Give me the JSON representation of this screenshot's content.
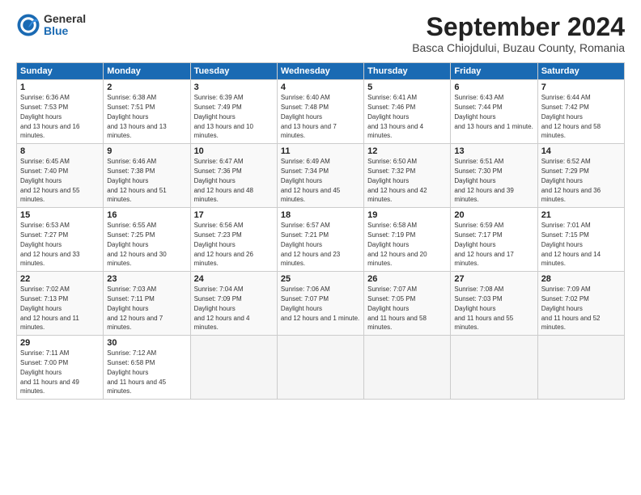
{
  "logo": {
    "general": "General",
    "blue": "Blue"
  },
  "title": "September 2024",
  "subtitle": "Basca Chiojdului, Buzau County, Romania",
  "headers": [
    "Sunday",
    "Monday",
    "Tuesday",
    "Wednesday",
    "Thursday",
    "Friday",
    "Saturday"
  ],
  "weeks": [
    [
      {
        "num": "1",
        "rise": "6:36 AM",
        "set": "7:53 PM",
        "daylight": "13 hours and 16 minutes."
      },
      {
        "num": "2",
        "rise": "6:38 AM",
        "set": "7:51 PM",
        "daylight": "13 hours and 13 minutes."
      },
      {
        "num": "3",
        "rise": "6:39 AM",
        "set": "7:49 PM",
        "daylight": "13 hours and 10 minutes."
      },
      {
        "num": "4",
        "rise": "6:40 AM",
        "set": "7:48 PM",
        "daylight": "13 hours and 7 minutes."
      },
      {
        "num": "5",
        "rise": "6:41 AM",
        "set": "7:46 PM",
        "daylight": "13 hours and 4 minutes."
      },
      {
        "num": "6",
        "rise": "6:43 AM",
        "set": "7:44 PM",
        "daylight": "13 hours and 1 minute."
      },
      {
        "num": "7",
        "rise": "6:44 AM",
        "set": "7:42 PM",
        "daylight": "12 hours and 58 minutes."
      }
    ],
    [
      {
        "num": "8",
        "rise": "6:45 AM",
        "set": "7:40 PM",
        "daylight": "12 hours and 55 minutes."
      },
      {
        "num": "9",
        "rise": "6:46 AM",
        "set": "7:38 PM",
        "daylight": "12 hours and 51 minutes."
      },
      {
        "num": "10",
        "rise": "6:47 AM",
        "set": "7:36 PM",
        "daylight": "12 hours and 48 minutes."
      },
      {
        "num": "11",
        "rise": "6:49 AM",
        "set": "7:34 PM",
        "daylight": "12 hours and 45 minutes."
      },
      {
        "num": "12",
        "rise": "6:50 AM",
        "set": "7:32 PM",
        "daylight": "12 hours and 42 minutes."
      },
      {
        "num": "13",
        "rise": "6:51 AM",
        "set": "7:30 PM",
        "daylight": "12 hours and 39 minutes."
      },
      {
        "num": "14",
        "rise": "6:52 AM",
        "set": "7:29 PM",
        "daylight": "12 hours and 36 minutes."
      }
    ],
    [
      {
        "num": "15",
        "rise": "6:53 AM",
        "set": "7:27 PM",
        "daylight": "12 hours and 33 minutes."
      },
      {
        "num": "16",
        "rise": "6:55 AM",
        "set": "7:25 PM",
        "daylight": "12 hours and 30 minutes."
      },
      {
        "num": "17",
        "rise": "6:56 AM",
        "set": "7:23 PM",
        "daylight": "12 hours and 26 minutes."
      },
      {
        "num": "18",
        "rise": "6:57 AM",
        "set": "7:21 PM",
        "daylight": "12 hours and 23 minutes."
      },
      {
        "num": "19",
        "rise": "6:58 AM",
        "set": "7:19 PM",
        "daylight": "12 hours and 20 minutes."
      },
      {
        "num": "20",
        "rise": "6:59 AM",
        "set": "7:17 PM",
        "daylight": "12 hours and 17 minutes."
      },
      {
        "num": "21",
        "rise": "7:01 AM",
        "set": "7:15 PM",
        "daylight": "12 hours and 14 minutes."
      }
    ],
    [
      {
        "num": "22",
        "rise": "7:02 AM",
        "set": "7:13 PM",
        "daylight": "12 hours and 11 minutes."
      },
      {
        "num": "23",
        "rise": "7:03 AM",
        "set": "7:11 PM",
        "daylight": "12 hours and 7 minutes."
      },
      {
        "num": "24",
        "rise": "7:04 AM",
        "set": "7:09 PM",
        "daylight": "12 hours and 4 minutes."
      },
      {
        "num": "25",
        "rise": "7:06 AM",
        "set": "7:07 PM",
        "daylight": "12 hours and 1 minute."
      },
      {
        "num": "26",
        "rise": "7:07 AM",
        "set": "7:05 PM",
        "daylight": "11 hours and 58 minutes."
      },
      {
        "num": "27",
        "rise": "7:08 AM",
        "set": "7:03 PM",
        "daylight": "11 hours and 55 minutes."
      },
      {
        "num": "28",
        "rise": "7:09 AM",
        "set": "7:02 PM",
        "daylight": "11 hours and 52 minutes."
      }
    ],
    [
      {
        "num": "29",
        "rise": "7:11 AM",
        "set": "7:00 PM",
        "daylight": "11 hours and 49 minutes."
      },
      {
        "num": "30",
        "rise": "7:12 AM",
        "set": "6:58 PM",
        "daylight": "11 hours and 45 minutes."
      },
      null,
      null,
      null,
      null,
      null
    ]
  ]
}
